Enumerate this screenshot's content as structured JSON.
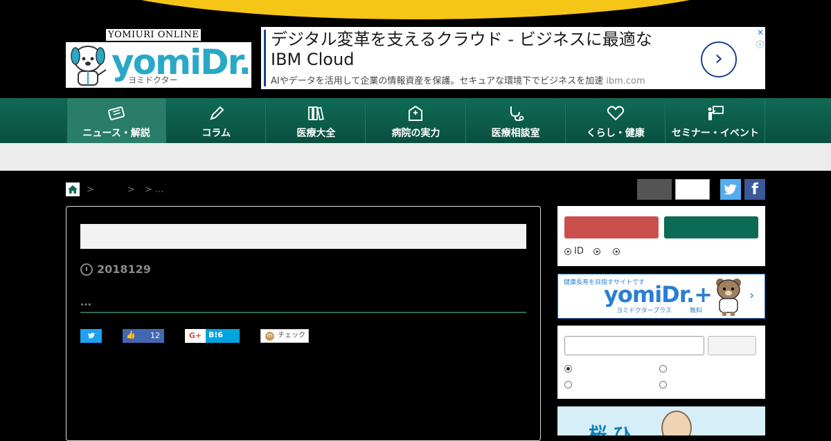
{
  "logo": {
    "top_text": "YOMIURI ONLINE",
    "word": "yomiDr.",
    "kana": "ヨミドクター"
  },
  "ad": {
    "title": "デジタル変革を支えるクラウド - ビジネスに最適な IBM Cloud",
    "subtitle": "AIやデータを活用して企業の情報資産を保護。セキュアな環境下でビジネスを加速",
    "domain": "ibm.com",
    "arrow": "›",
    "close": "✕",
    "info": "ⓘ"
  },
  "nav": {
    "items": [
      {
        "label": "ニュース・解説",
        "icon": "newspaper-icon",
        "active": true
      },
      {
        "label": "コラム",
        "icon": "pencil-icon"
      },
      {
        "label": "医療大全",
        "icon": "books-icon"
      },
      {
        "label": "病院の実力",
        "icon": "hospital-icon"
      },
      {
        "label": "医療相談室",
        "icon": "stethoscope-icon"
      },
      {
        "label": "くらし・健康",
        "icon": "heart-icon"
      },
      {
        "label": "セミナー・イベント",
        "icon": "presentation-icon"
      }
    ]
  },
  "breadcrumb": {
    "sep1": ">",
    "sep2": ">",
    "sep3": "> …"
  },
  "article": {
    "date": "2018129",
    "dots": "…",
    "share": {
      "like_count": "12",
      "hatena_count": "6",
      "hatena_label": "B!",
      "gplus_label": "G+",
      "mixi_label": "チェック"
    }
  },
  "sidebar": {
    "login_links": [
      "ID",
      "",
      ""
    ],
    "banner": {
      "top": "健康長寿を目指すサイトです",
      "word": "yomiDr.+",
      "kana": "ヨミドクタープラス",
      "free": "無料",
      "chevron": "›"
    },
    "ad2_text": "桜 ひ"
  },
  "colors": {
    "nav_green": "#0f6b55",
    "accent_yellow": "#f5c518",
    "twitter": "#55acee",
    "facebook": "#3b5998",
    "login_red": "#c9504d"
  }
}
